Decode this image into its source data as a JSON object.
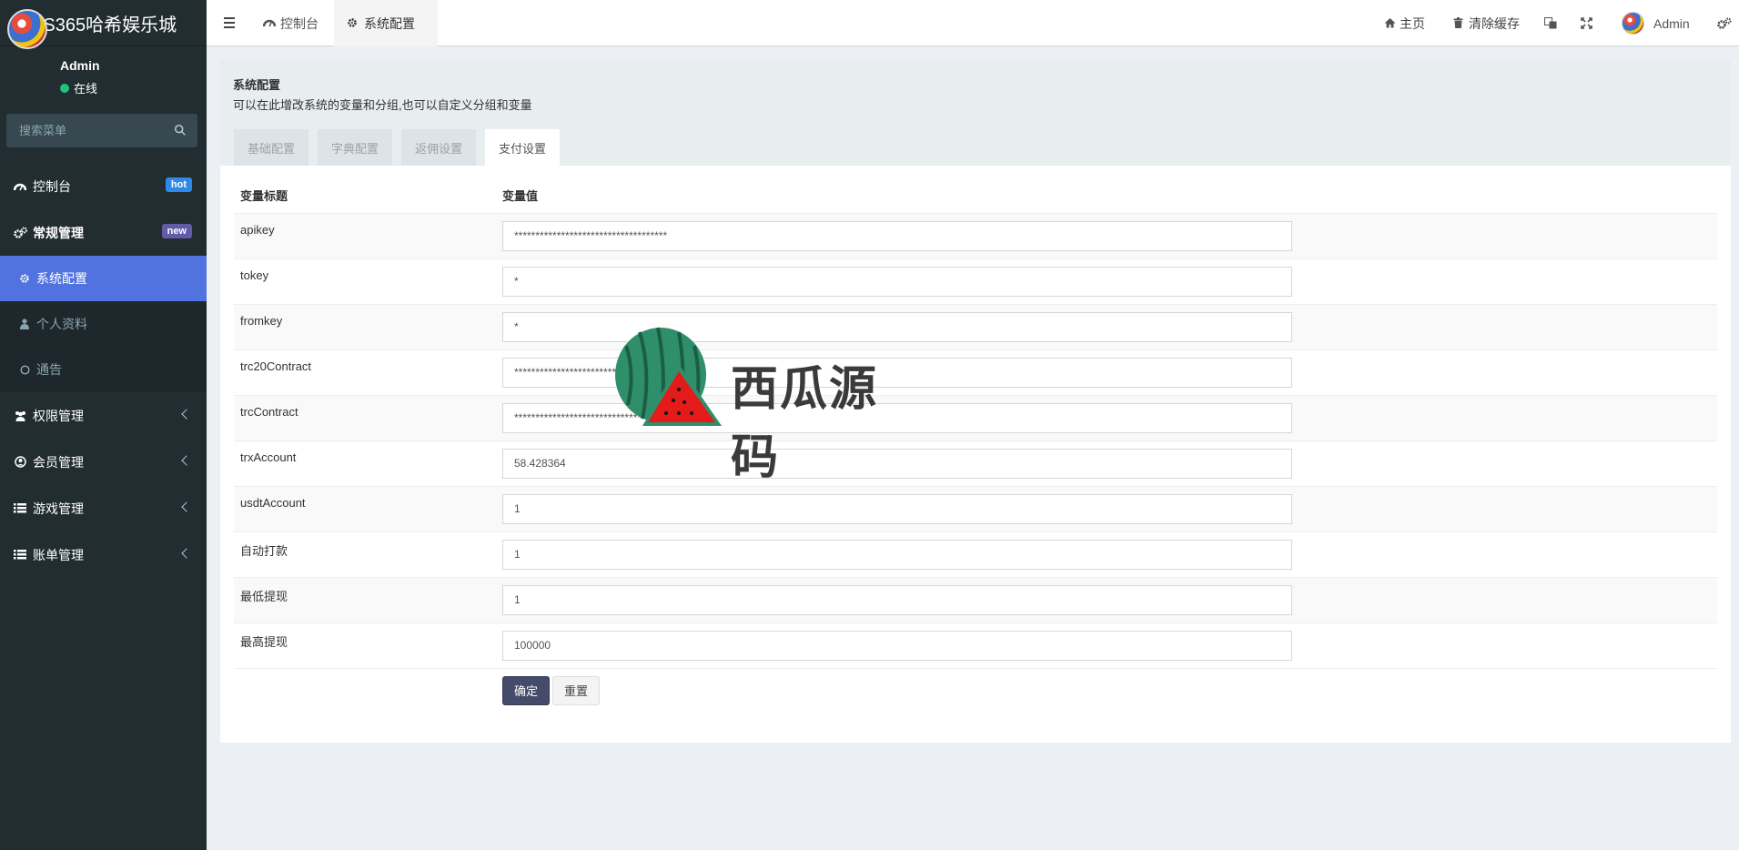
{
  "sidebar": {
    "brand": "DS365哈希娱乐城",
    "user": {
      "name": "Admin",
      "status": "在线"
    },
    "search_placeholder": "搜索菜单",
    "menu": [
      {
        "label": "控制台",
        "badge": "hot"
      },
      {
        "label": "常规管理",
        "badge": "new"
      },
      {
        "label": "权限管理"
      },
      {
        "label": "会员管理"
      },
      {
        "label": "游戏管理"
      },
      {
        "label": "账单管理"
      }
    ],
    "submenu": [
      {
        "label": "系统配置"
      },
      {
        "label": "个人资料"
      },
      {
        "label": "通告"
      }
    ]
  },
  "topbar": {
    "tabs": [
      {
        "label": "控制台"
      },
      {
        "label": "系统配置"
      }
    ],
    "home": "主页",
    "clear_cache": "清除缓存",
    "user": "Admin"
  },
  "panel": {
    "title": "系统配置",
    "description": "可以在此增改系统的变量和分组,也可以自定义分组和变量",
    "tabs": [
      {
        "label": "基础配置"
      },
      {
        "label": "字典配置"
      },
      {
        "label": "返佣设置"
      },
      {
        "label": "支付设置"
      }
    ],
    "col_title": "变量标题",
    "col_value": "变量值",
    "rows": [
      {
        "label": "apikey",
        "value": "************************************"
      },
      {
        "label": "tokey",
        "value": "*"
      },
      {
        "label": "fromkey",
        "value": "*"
      },
      {
        "label": "trc20Contract",
        "value": "**********************************"
      },
      {
        "label": "trcContract",
        "value": "**********************************"
      },
      {
        "label": "trxAccount",
        "value": "58.428364"
      },
      {
        "label": "usdtAccount",
        "value": "1"
      },
      {
        "label": "自动打款",
        "value": "1"
      },
      {
        "label": "最低提现",
        "value": "1"
      },
      {
        "label": "最高提现",
        "value": "100000"
      }
    ],
    "confirm": "确定",
    "reset": "重置"
  },
  "watermark": "西瓜源码"
}
